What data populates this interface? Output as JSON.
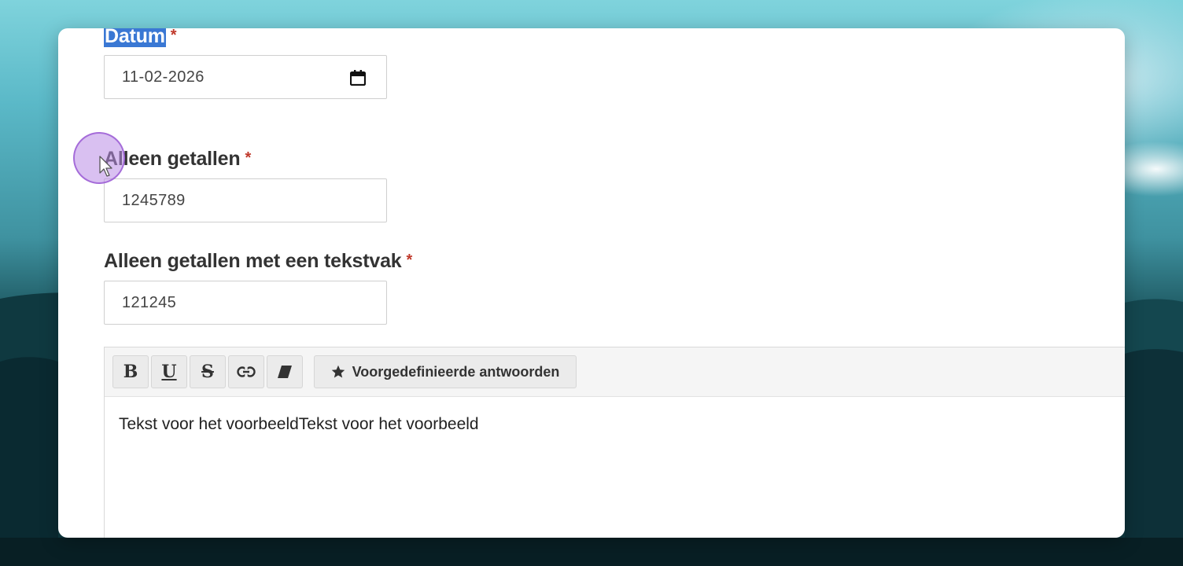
{
  "form": {
    "date_field": {
      "label": "Datum",
      "required_mark": "*",
      "value": "11-02-2026",
      "icon": "calendar-icon"
    },
    "numbers_field": {
      "label": "Alleen getallen",
      "required_mark": "*",
      "value": "1245789"
    },
    "numbers_textbox_field": {
      "label": "Alleen getallen met een tekstvak",
      "required_mark": "*",
      "value": "121245"
    },
    "editor": {
      "toolbar": {
        "bold_label": "B",
        "underline_label": "U",
        "strike_label": "S",
        "link_icon": "link-icon",
        "eraser_icon": "eraser-icon",
        "answers_icon": "star-icon",
        "answers_label": "Voorgedefinieerde antwoorden"
      },
      "content": "Tekst voor het voorbeeldTekst voor het voorbeeld"
    }
  },
  "colors": {
    "required": "#c0392b",
    "selection": "#3a78d4",
    "cursor_highlight": "#ba8ce6"
  }
}
